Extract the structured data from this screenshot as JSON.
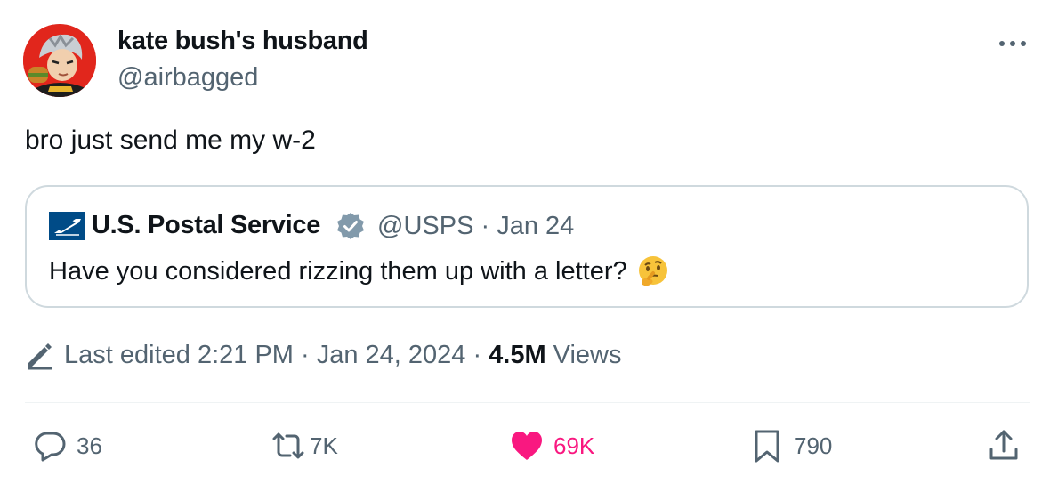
{
  "author": {
    "display_name": "kate bush's husband",
    "handle": "@airbagged",
    "avatar_icon": "anime-character-avatar"
  },
  "more_icon": "ellipsis-icon",
  "tweet": {
    "text": "bro just send me my w-2"
  },
  "quoted_tweet": {
    "account_icon": "usps-eagle-logo",
    "name": "U.S. Postal Service",
    "verified_icon": "verified-badge-icon",
    "handle": "@USPS",
    "separator": "·",
    "date": "Jan 24",
    "text": "Have you considered rizzing them up with a letter?",
    "emoji": "thinking-face-emoji"
  },
  "edit_info": {
    "icon": "pencil-icon",
    "label": "Last edited 2:21 PM · Jan 24, 2024 ·",
    "views_count": "4.5M",
    "views_label": "Views"
  },
  "actions": {
    "replies": "36",
    "reposts": "7K",
    "likes": "69K",
    "bookmarks": "790"
  },
  "colors": {
    "text_primary": "#0f1419",
    "text_secondary": "#536471",
    "border": "#cfd9de",
    "like_pink": "#f91880",
    "verified_gray": "#829aab",
    "usps_blue": "#004b87"
  }
}
